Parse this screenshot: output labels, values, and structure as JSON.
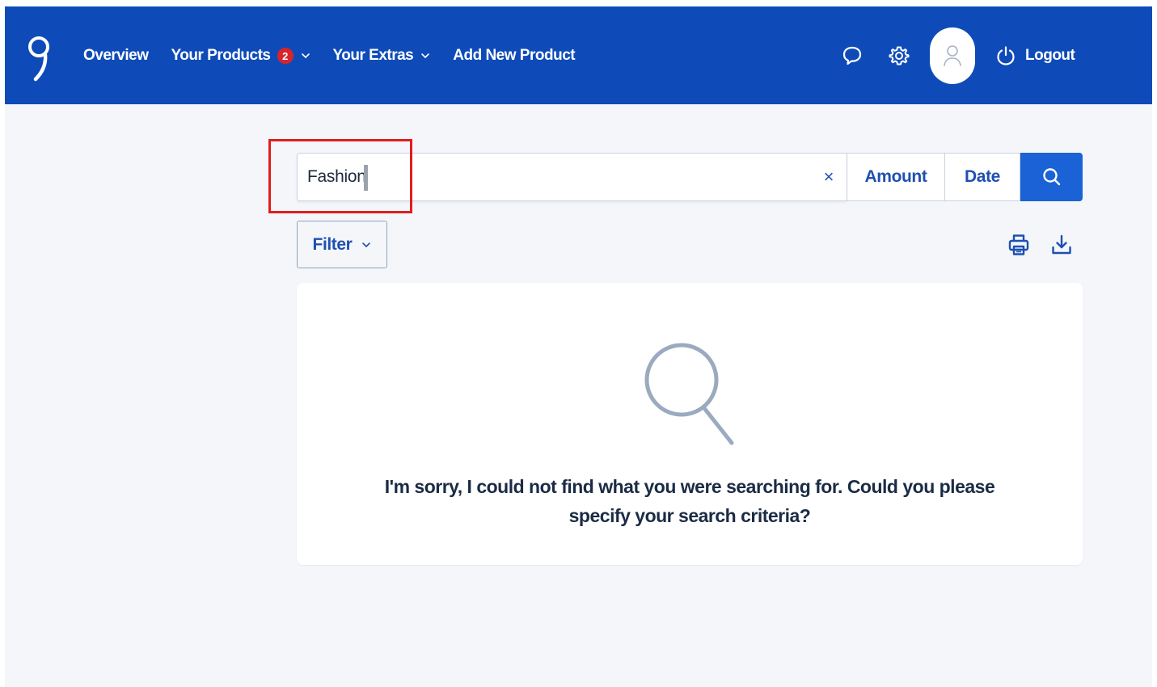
{
  "nav": {
    "items": [
      {
        "label": "Overview",
        "has_badge": false,
        "has_chevron": false
      },
      {
        "label": "Your Products",
        "badge": "2",
        "has_chevron": true
      },
      {
        "label": "Your Extras",
        "has_chevron": true
      },
      {
        "label": "Add New Product",
        "has_chevron": false
      }
    ],
    "logout_label": "Logout",
    "icons": [
      "chat-icon",
      "gear-icon",
      "user-icon",
      "power-icon"
    ]
  },
  "search": {
    "value": "Fashion",
    "clear_symbol": "×",
    "amount_label": "Amount",
    "date_label": "Date"
  },
  "filter": {
    "label": "Filter"
  },
  "results": {
    "empty_message": "I'm sorry, I could not find what you were searching for. Could you please specify your search criteria?"
  },
  "colors": {
    "header_bg": "#0e4bb8",
    "accent": "#1a62d6",
    "link_text": "#1f4fb0",
    "badge": "#d8242b",
    "highlight": "#e01d1d",
    "page_bg": "#f4f6fa"
  }
}
